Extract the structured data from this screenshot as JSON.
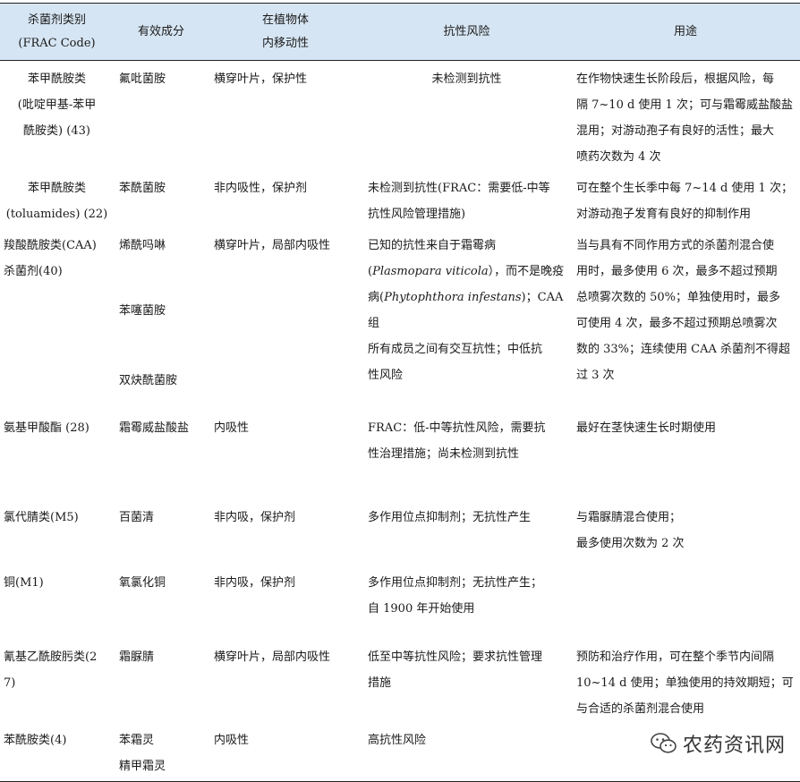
{
  "table": {
    "headers": [
      [
        "杀菌剂类别",
        "(FRAC Code)"
      ],
      [
        "有效成分"
      ],
      [
        "在植物体",
        "内移动性"
      ],
      [
        "抗性风险"
      ],
      [
        "用途"
      ]
    ],
    "rows": [
      {
        "category": [
          "苯甲酰胺类",
          "(吡啶甲基-苯甲",
          "酰胺类) (43)"
        ],
        "ingredients": [
          "氟吡菌胺"
        ],
        "mobility": [
          "横穿叶片，保护性"
        ],
        "risk": [
          "未检测到抗性"
        ],
        "usage": [
          "在作物快速生长阶段后，根据风险，每",
          "隔 7~10 d 使用 1 次；可与霜霉威盐酸盐",
          "混用；对游动孢子有良好的活性；最大",
          "喷药次数为 4 次"
        ]
      },
      {
        "category": [
          "苯甲酰胺类",
          "(toluamides) (22)"
        ],
        "ingredients": [
          "苯酰菌胺"
        ],
        "mobility": [
          "非内吸性，保护剂"
        ],
        "risk": [
          "未检测到抗性(FRAC：需要低-中等",
          "抗性风险管理措施)"
        ],
        "usage": [
          "可在整个生长季中每 7~14 d 使用 1 次；",
          "对游动孢子发育有良好的抑制作用"
        ]
      },
      {
        "category": [
          "羧酸酰胺类(CAA)",
          "杀菌剂(40)"
        ],
        "ingredients": [
          "烯酰吗啉",
          "",
          "苯噻菌胺",
          "",
          "双炔酰菌胺"
        ],
        "mobility": [
          "横穿叶片，局部内吸性"
        ],
        "risk_parts": {
          "l1": "已知的抗性来自于霜霉病",
          "l2_italic": "Plasmopara viticola",
          "l2_rest": "），而不是晚疫",
          "l3_pre": "病(",
          "l3_italic": "Phytophthora infestans",
          "l3_rest": ")；CAA 组",
          "l4": "所有成员之间有交互抗性；中低抗",
          "l5": "性风险"
        },
        "usage": [
          "当与具有不同作用方式的杀菌剂混合使",
          "用时，最多使用 6 次，最多不超过预期",
          "总喷雾次数的 50%；单独使用时，最多",
          "可使用 4 次，最多不超过预期总喷雾次",
          "数的 33%；连续使用 CAA 杀菌剂不得超",
          "过 3 次"
        ]
      },
      {
        "category": [
          "氨基甲酸酯 (28)"
        ],
        "ingredients": [
          "霜霉威盐酸盐"
        ],
        "mobility": [
          "内吸性"
        ],
        "risk": [
          "FRAC：低-中等抗性风险，需要抗",
          "性治理措施；尚未检测到抗性"
        ],
        "usage": [
          "最好在茎快速生长时期使用"
        ]
      },
      {
        "category": [
          "氯代腈类(M5)"
        ],
        "ingredients": [
          "百菌清"
        ],
        "mobility": [
          "非内吸，保护剂"
        ],
        "risk": [
          "多作用位点抑制剂；无抗性产生"
        ],
        "usage": [
          "与霜脲腈混合使用；",
          "最多使用次数为 2 次"
        ]
      },
      {
        "category": [
          "铜(M1)"
        ],
        "ingredients": [
          "氧氯化铜"
        ],
        "mobility": [
          "非内吸，保护剂"
        ],
        "risk": [
          "多作用位点抑制剂；无抗性产生；",
          "自 1900 年开始使用"
        ],
        "usage": []
      },
      {
        "category": [
          "氰基乙酰胺肟类(27)"
        ],
        "ingredients": [
          "霜脲腈"
        ],
        "mobility": [
          "横穿叶片，局部内吸性"
        ],
        "risk": [
          "低至中等抗性风险；要求抗性管理",
          "措施"
        ],
        "usage": [
          "预防和治疗作用，可在整个季节内间隔",
          "10~14 d 使用；单独使用的持效期短；可",
          "与合适的杀菌剂混合使用"
        ]
      },
      {
        "category": [
          "苯酰胺类(4)"
        ],
        "ingredients": [
          "苯霜灵",
          "精甲霜灵"
        ],
        "mobility": [
          "内吸性"
        ],
        "risk": [
          "高抗性风险"
        ],
        "usage": []
      }
    ]
  },
  "watermark": {
    "text": "农药资讯网",
    "icon": "wechat-icon"
  },
  "colors": {
    "header_bg": "#d6e5f3",
    "rule": "#222222"
  }
}
